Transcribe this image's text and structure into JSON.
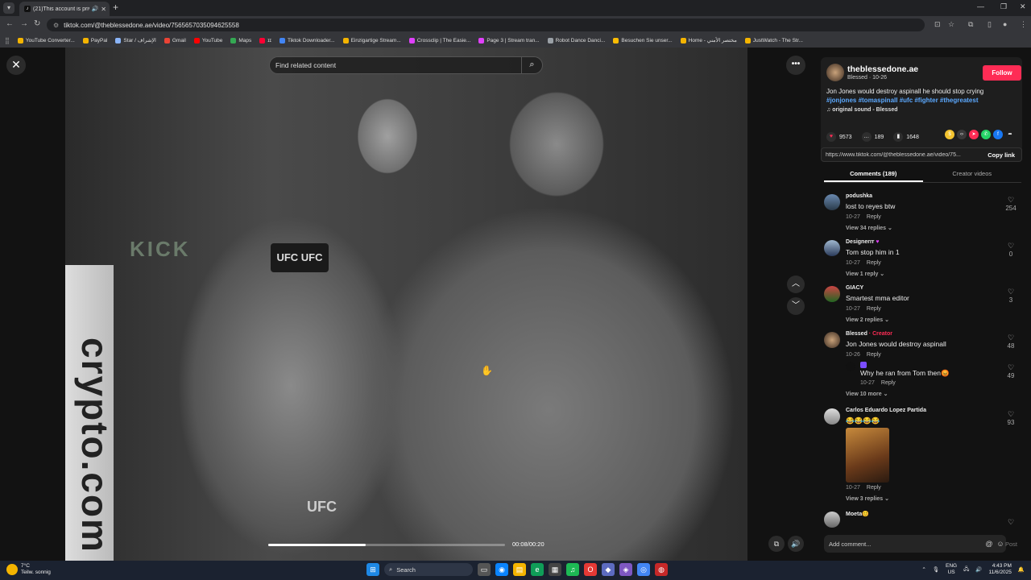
{
  "browser": {
    "tab_title": "(21)This account is private.",
    "tab_icon": "tiktok-icon",
    "url": "tiktok.com/@theblessedone.ae/video/7565657035094625558",
    "bookmarks": [
      {
        "label": "YouTube Converter...",
        "color": "#f4b400"
      },
      {
        "label": "PayPal",
        "color": "#f4b400"
      },
      {
        "label": "Star / الإشراف",
        "color": "#8ab4f8"
      },
      {
        "label": "Gmail",
        "color": "#ea4335"
      },
      {
        "label": "YouTube",
        "color": "#ff0000"
      },
      {
        "label": "Maps",
        "color": "#34a853"
      },
      {
        "label": "ɪɪ",
        "color": "#ff0033"
      },
      {
        "label": "Tiktok Downloader...",
        "color": "#4285f4"
      },
      {
        "label": "Einzigartige Stream...",
        "color": "#f4b400"
      },
      {
        "label": "Crossclip | The Easie...",
        "color": "#e040fb"
      },
      {
        "label": "Page 3 | Stream tran...",
        "color": "#e040fb"
      },
      {
        "label": "Robot Dance Danci...",
        "color": "#9aa0a6"
      },
      {
        "label": "Besuchen Sie unser...",
        "color": "#fbbc04"
      },
      {
        "label": "Home - مختصر الأمني",
        "color": "#f4b400"
      },
      {
        "label": "JustWatch - The Str...",
        "color": "#f4b400"
      }
    ]
  },
  "search": {
    "placeholder": "Find related content"
  },
  "video": {
    "time": "00:08/00:20",
    "progress": 0.41,
    "pole_text": "crypto.com",
    "kick_text": "KICK",
    "mic_text": "UFC UFC",
    "shorts_text": "UFC"
  },
  "post": {
    "username": "theblessedone.ae",
    "subtitle": "Blessed · 10-26",
    "follow": "Follow",
    "caption": "Jon Jones would destroy aspinall he should stop crying",
    "hashtags": "#jonjones #tomaspinall #ufc #fighter #thegreatest",
    "sound": "original sound - Blessed",
    "likes": "9573",
    "comments": "189",
    "saves": "1648",
    "link": "https://www.tiktok.com/@theblessedone.ae/video/75...",
    "copy_link": "Copy link",
    "tab_comments": "Comments (189)",
    "tab_creator": "Creator videos"
  },
  "comments": [
    {
      "name": "podushka",
      "text": "lost to reyes btw",
      "date": "10-27",
      "reply": "Reply",
      "likes": "254",
      "replies": "View 34 replies"
    },
    {
      "name": "Designerrr",
      "text": "Tom stop him in 1",
      "date": "10-27",
      "reply": "Reply",
      "likes": "0",
      "replies": "View 1 reply"
    },
    {
      "name": "GIACY",
      "text": "Smartest mma editor",
      "date": "10-27",
      "reply": "Reply",
      "likes": "3",
      "replies": "View 2 replies"
    },
    {
      "name": "Blessed",
      "creator": " · Creator",
      "text": "Jon Jones would destroy aspinall",
      "date": "10-26",
      "reply": "Reply",
      "likes": "48"
    },
    {
      "name": "",
      "text": "Why he ran from Tom then😡",
      "date": "10-27",
      "reply": "Reply",
      "likes": "49",
      "replies": "View 10 more"
    },
    {
      "name": "Carlos Eduardo Lopez Partida",
      "text": "😂😂😂😂",
      "date": "10-27",
      "reply": "Reply",
      "likes": "93",
      "replies": "View 3 replies"
    },
    {
      "name": "Moeta😊",
      "likes": ""
    }
  ],
  "comment_input": {
    "placeholder": "Add comment...",
    "post": "Post"
  },
  "taskbar": {
    "temp": "7°C",
    "weather": "Teilw. sonnig",
    "search": "Search",
    "lang": "ENG",
    "region": "US",
    "time": "4:43 PM",
    "date": "11/6/2025"
  }
}
